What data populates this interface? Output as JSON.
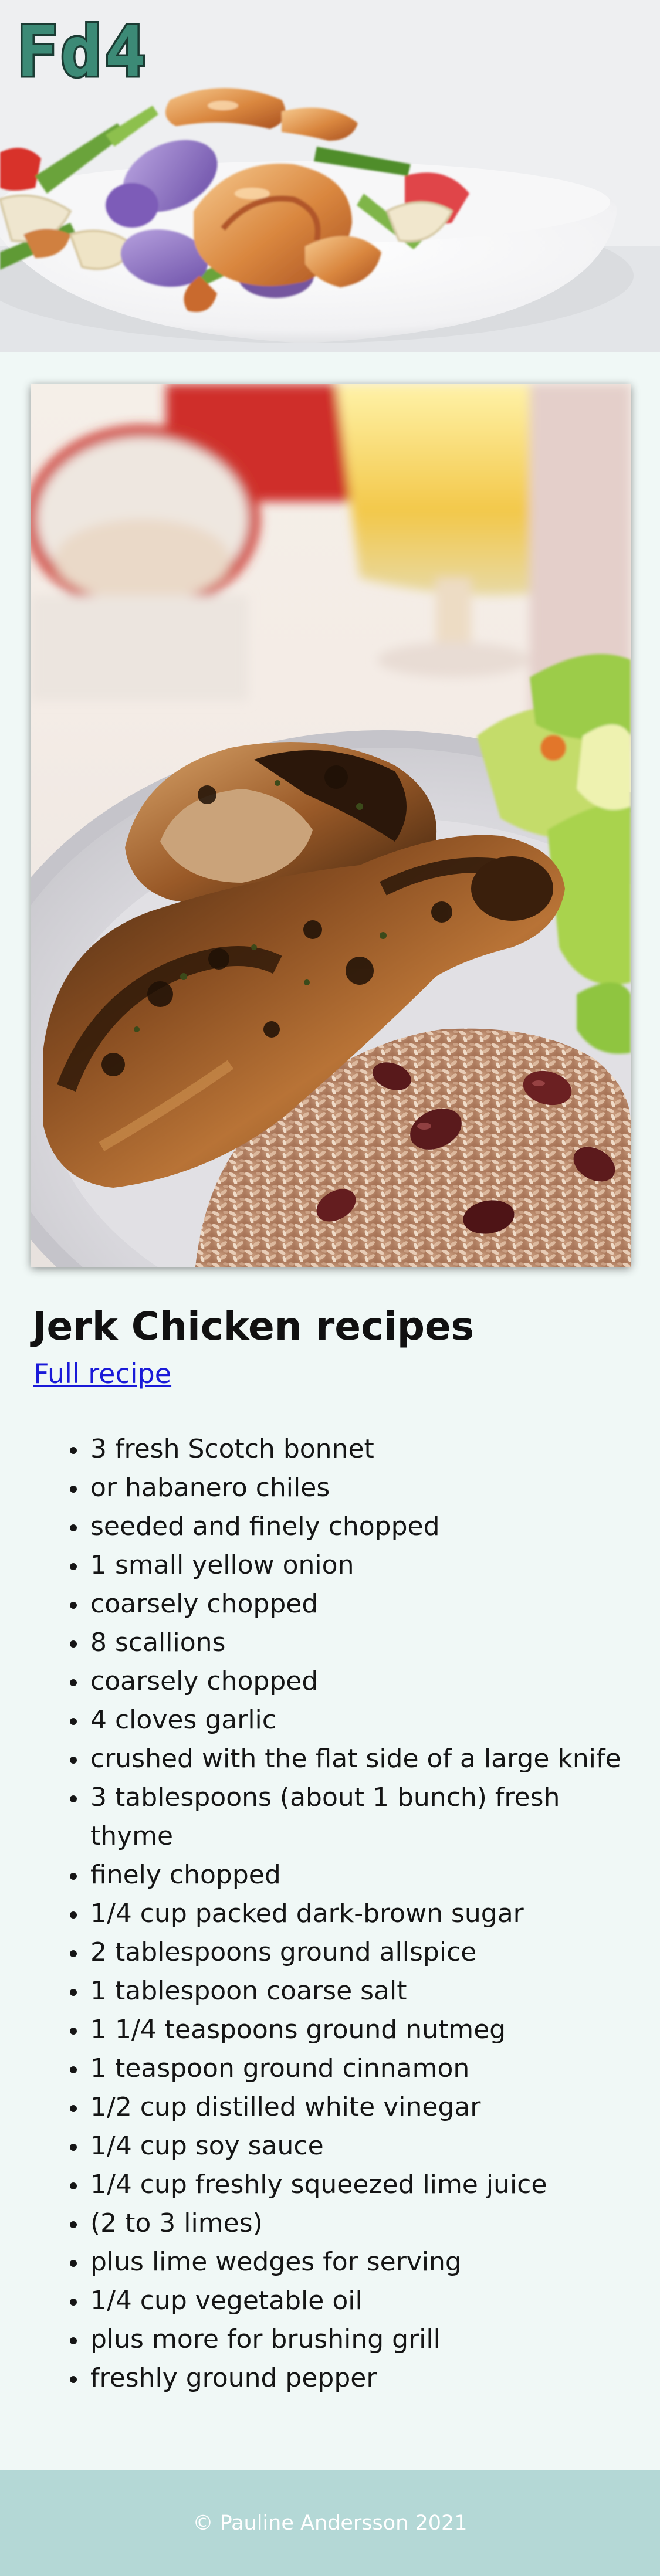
{
  "header": {
    "logo_text": "Fd4",
    "logo_color": "#3c8a76",
    "hero_image": "shrimp-stir-fry-photo"
  },
  "photo": {
    "image": "jerk-chicken-with-rice-and-peas-photo"
  },
  "recipe": {
    "title": "Jerk Chicken recipes",
    "link_label": "Full recipe",
    "ingredients": [
      "3 fresh Scotch bonnet",
      "or habanero chiles",
      "seeded and finely chopped",
      "1 small yellow onion",
      "coarsely chopped",
      "8 scallions",
      "coarsely chopped",
      "4 cloves garlic",
      "crushed with the flat side of a large knife",
      "3 tablespoons (about 1 bunch) fresh thyme",
      "finely chopped",
      "1/4 cup packed dark-brown sugar",
      "2 tablespoons ground allspice",
      "1 tablespoon coarse salt",
      "1 1/4 teaspoons ground nutmeg",
      "1 teaspoon ground cinnamon",
      "1/2 cup distilled white vinegar",
      "1/4 cup soy sauce",
      "1/4 cup freshly squeezed lime juice",
      "(2 to 3 limes)",
      "plus lime wedges for serving",
      "1/4 cup vegetable oil",
      "plus more for brushing grill",
      "freshly ground pepper"
    ]
  },
  "footer": {
    "copyright": "© Pauline Andersson 2021",
    "background_color": "#b4d8d6"
  },
  "colors": {
    "page_background": "#f0f8f6",
    "link": "#1a1ad8"
  }
}
